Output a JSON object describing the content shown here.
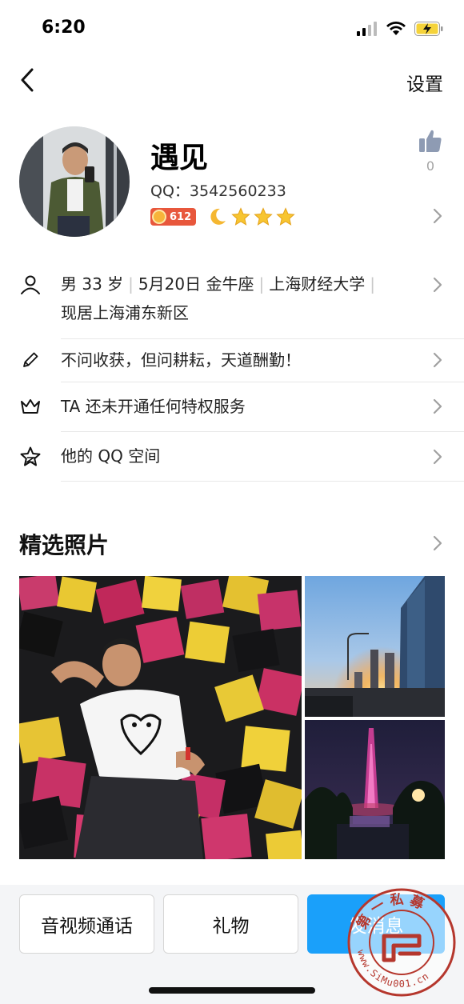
{
  "status_bar": {
    "time": "6:20"
  },
  "nav": {
    "settings": "设置"
  },
  "profile": {
    "nickname": "遇见",
    "qq": "QQ：3542560233",
    "level": "612",
    "likes": "0"
  },
  "info_rows": {
    "basic_gender": "男 33 岁",
    "basic_birthday": "5月20日 金牛座",
    "basic_school": "上海财经大学",
    "basic_location": "现居上海浦东新区",
    "signature": "不问收获，但问耕耘，天道酬勤！",
    "privilege": "TA 还未开通任何特权服务",
    "qzone": "他的 QQ 空间"
  },
  "photos": {
    "title": "精选照片"
  },
  "actions": {
    "call": "音视频通话",
    "gift": "礼物",
    "message": "发消息"
  },
  "watermark": {
    "text_top": "第一私募",
    "text_bottom": "www.SiMu001.cn"
  },
  "colors": {
    "accent": "#1aa0fa",
    "level_badge": "#e8573c",
    "star": "#f7c531",
    "moon": "#f5b731",
    "watermark_red": "#b5372d"
  }
}
